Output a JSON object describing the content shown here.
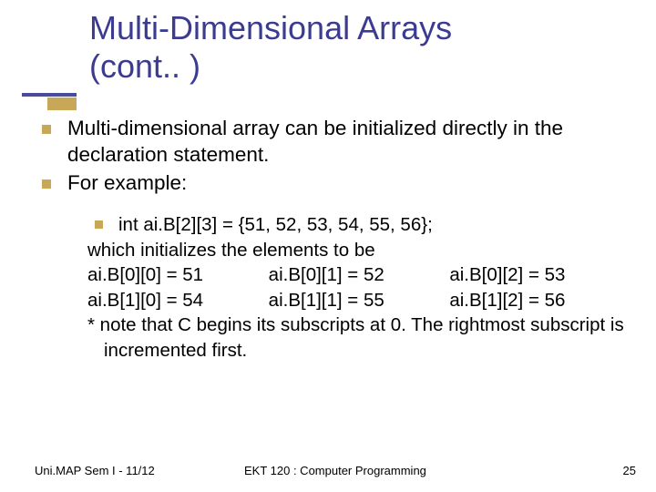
{
  "title": {
    "line1": "Multi-Dimensional Arrays",
    "line2": "(cont.. )"
  },
  "bullets": [
    "Multi-dimensional array can be initialized directly in the declaration statement.",
    "For example:"
  ],
  "sub": {
    "code_line": "int ai.B[2][3] = {51, 52, 53, 54, 55, 56};",
    "intro": "which initializes the elements to be",
    "grid": [
      [
        "ai.B[0][0] = 51",
        "ai.B[0][1] = 52",
        "ai.B[0][2] = 53"
      ],
      [
        "ai.B[1][0] = 54",
        "ai.B[1][1] = 55",
        "ai.B[1][2] = 56"
      ]
    ],
    "note": "* note that C begins its subscripts at 0. The rightmost subscript is incremented first."
  },
  "footer": {
    "left": "Uni.MAP Sem I - 11/12",
    "center": "EKT 120 : Computer Programming",
    "page": "25"
  }
}
